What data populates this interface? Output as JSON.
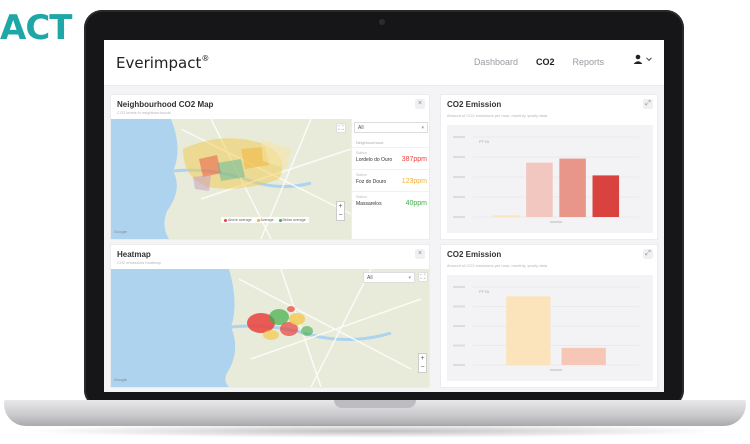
{
  "brand_fragment": "ACT",
  "app": {
    "logo": "Everimpact",
    "logo_mark": "®",
    "nav": [
      {
        "label": "Dashboard",
        "active": false
      },
      {
        "label": "CO2",
        "active": true
      },
      {
        "label": "Reports",
        "active": false
      }
    ],
    "user_icon": "user-icon"
  },
  "neighbourhood_map": {
    "title": "Neighbourhood CO2 Map",
    "subtitle": "CO2 levels in neighbourhoods",
    "dropdown_value": "All",
    "list_header": "Neighbourhood",
    "stations": [
      {
        "meta": "Station",
        "name": "Lordelo do Ouro",
        "value": "387ppm",
        "color": "#e8413c"
      },
      {
        "meta": "Station",
        "name": "Foz do Douro",
        "value": "123ppm",
        "color": "#f2b134"
      },
      {
        "meta": "Station",
        "name": "Massarelos",
        "value": "40ppm",
        "color": "#3fae49"
      }
    ],
    "legend": [
      {
        "label": "Above average",
        "color": "#e8413c"
      },
      {
        "label": "Average",
        "color": "#f2b134"
      },
      {
        "label": "Below average",
        "color": "#3fae49"
      }
    ],
    "credit": "Google"
  },
  "heatmap": {
    "title": "Heatmap",
    "subtitle": "CO2 emissions heatmap",
    "dropdown_value": "All",
    "credit": "Google"
  },
  "colors": {
    "teal": "#1fa6a6",
    "bar_light": "#f2c7c0",
    "bar_mid": "#e8968a",
    "bar_dark": "#d9423e",
    "bar_yellow": "#fbe4bb",
    "bar_pink": "#f6c6b6"
  },
  "emission_charts": [
    {
      "title": "CO2 Emission",
      "subtitle": "Amount of CO2 emissions per hour, monthly, yearly data",
      "chart_data": {
        "type": "bar",
        "title": "CO2 Emission",
        "series_label": "PTYA",
        "values": [
          2,
          68,
          73,
          52
        ],
        "colors": [
          "#fbe4bb",
          "#f2c7c0",
          "#e8968a",
          "#d9423e"
        ],
        "xlabel": "",
        "ylabel": "",
        "ylim": [
          0,
          100
        ]
      }
    },
    {
      "title": "CO2 Emission",
      "subtitle": "Amount of CO2 emissions per hour, monthly, yearly data",
      "chart_data": {
        "type": "bar",
        "title": "CO2 Emission",
        "series_label": "PTYA",
        "values": [
          88,
          22
        ],
        "colors": [
          "#fbe4bb",
          "#f6c6b6"
        ],
        "xlabel": "",
        "ylabel": "",
        "ylim": [
          0,
          100
        ]
      }
    }
  ]
}
